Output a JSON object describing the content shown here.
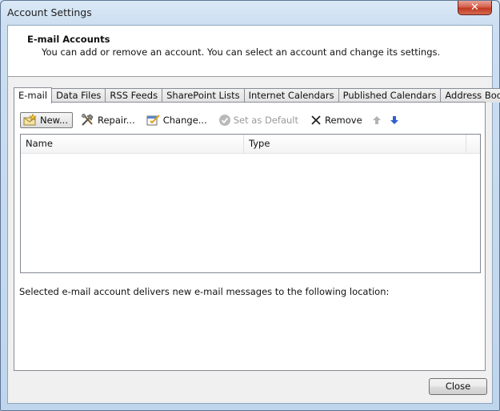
{
  "window": {
    "title": "Account Settings",
    "close_glyph": "✕"
  },
  "header": {
    "title": "E-mail Accounts",
    "description": "You can add or remove an account. You can select an account and change its settings."
  },
  "tabs": [
    {
      "label": "E-mail",
      "active": true
    },
    {
      "label": "Data Files",
      "active": false
    },
    {
      "label": "RSS Feeds",
      "active": false
    },
    {
      "label": "SharePoint Lists",
      "active": false
    },
    {
      "label": "Internet Calendars",
      "active": false
    },
    {
      "label": "Published Calendars",
      "active": false
    },
    {
      "label": "Address Books",
      "active": false
    }
  ],
  "toolbar": {
    "new_label": "New...",
    "repair_label": "Repair...",
    "change_label": "Change...",
    "set_default_label": "Set as Default",
    "remove_label": "Remove",
    "move_up_icon": "arrow-up-icon",
    "move_down_icon": "arrow-down-icon"
  },
  "accounts_list": {
    "columns": [
      "Name",
      "Type"
    ],
    "rows": []
  },
  "location_text": "Selected e-mail account delivers new e-mail messages to the following location:",
  "footer": {
    "close_label": "Close"
  },
  "colors": {
    "title_close_red": "#c23a22",
    "move_down_blue": "#2f5fd0",
    "disabled_gray": "#9a9a9a"
  }
}
